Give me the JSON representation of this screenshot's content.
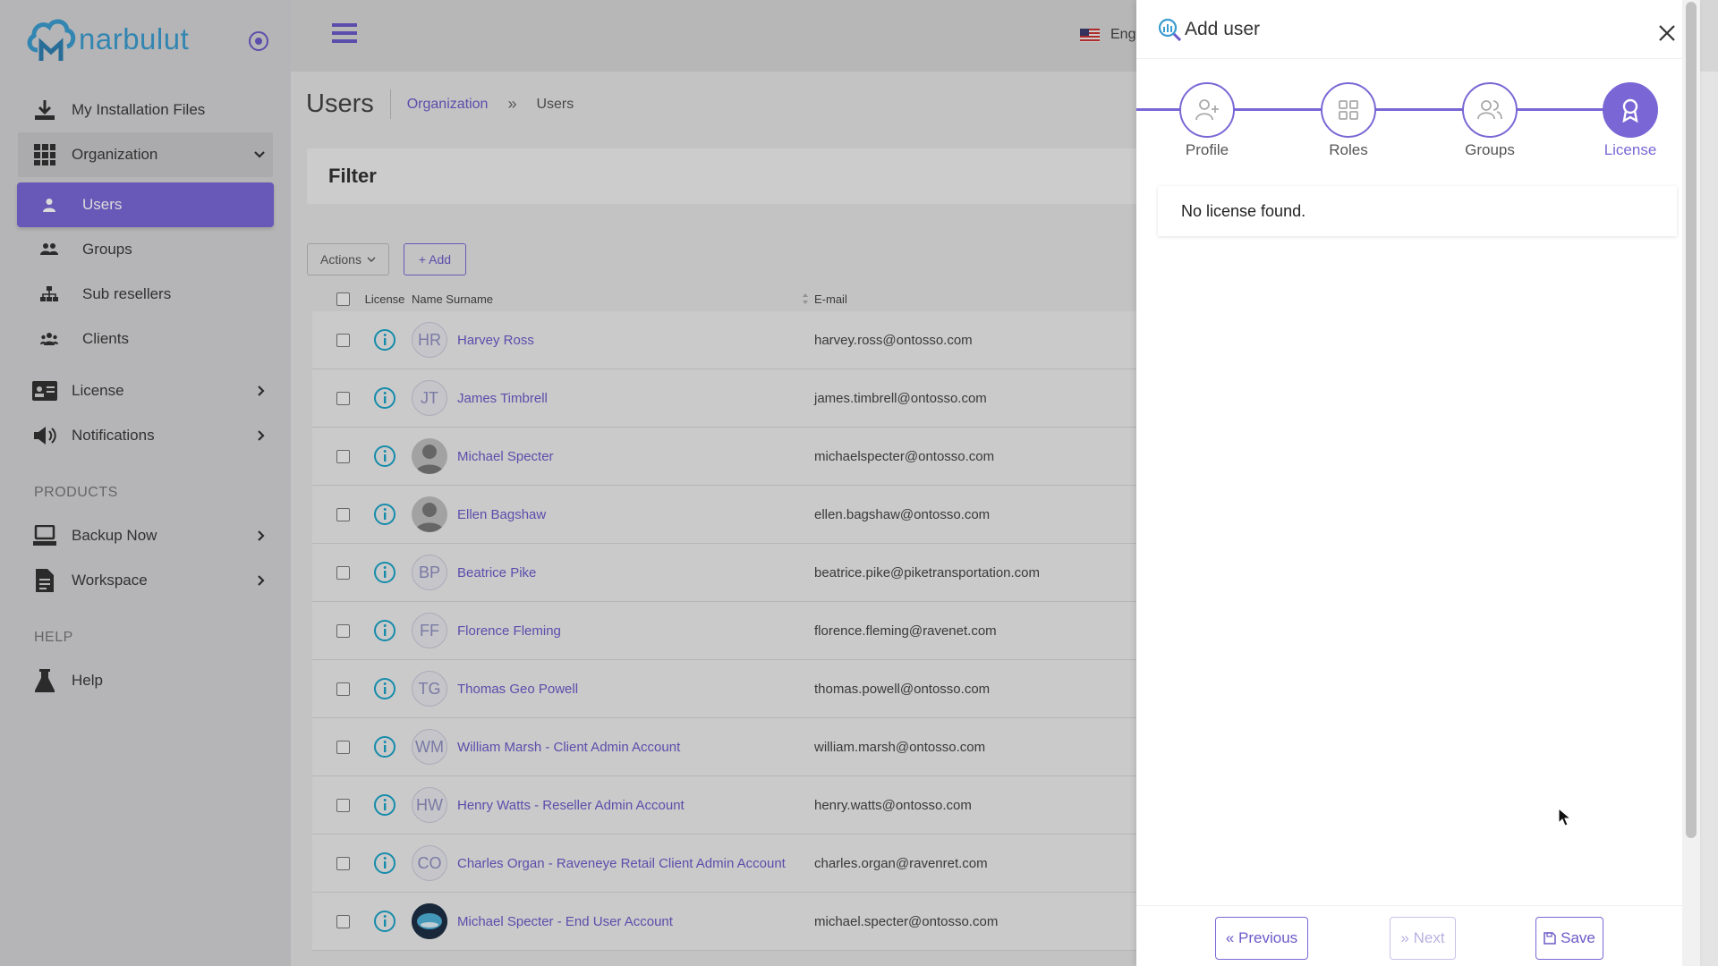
{
  "app": {
    "brand": "narbulut"
  },
  "sidebar": {
    "items": [
      {
        "label": "My Installation Files",
        "icon": "download-icon"
      },
      {
        "label": "Organization",
        "icon": "grid-icon"
      },
      {
        "label": "Users",
        "icon": "user-icon"
      },
      {
        "label": "Groups",
        "icon": "users-icon"
      },
      {
        "label": "Sub resellers",
        "icon": "sitemap-icon"
      },
      {
        "label": "Clients",
        "icon": "clients-icon"
      },
      {
        "label": "License",
        "icon": "id-card-icon"
      },
      {
        "label": "Notifications",
        "icon": "megaphone-icon"
      }
    ],
    "products_label": "PRODUCTS",
    "products": [
      {
        "label": "Backup Now",
        "icon": "server-icon"
      },
      {
        "label": "Workspace",
        "icon": "document-icon"
      }
    ],
    "help_label": "HELP",
    "help": {
      "label": "Help",
      "icon": "flask-icon"
    }
  },
  "header": {
    "language": "Eng"
  },
  "page": {
    "title": "Users",
    "breadcrumb": {
      "parent": "Organization",
      "sep": "»",
      "current": "Users"
    },
    "filter_title": "Filter",
    "actions_label": "Actions",
    "add_label": "+ Add"
  },
  "table": {
    "headers": {
      "license": "License",
      "name": "Name Surname",
      "email": "E-mail"
    },
    "rows": [
      {
        "initials": "HR",
        "name": "Harvey Ross",
        "email": "harvey.ross@ontosso.com",
        "avatar": "initials"
      },
      {
        "initials": "JT",
        "name": "James Timbrell",
        "email": "james.timbrell@ontosso.com",
        "avatar": "initials"
      },
      {
        "initials": "",
        "name": "Michael Specter",
        "email": "michaelspecter@ontosso.com",
        "avatar": "photo"
      },
      {
        "initials": "",
        "name": "Ellen Bagshaw",
        "email": "ellen.bagshaw@ontosso.com",
        "avatar": "photo"
      },
      {
        "initials": "BP",
        "name": "Beatrice Pike",
        "email": "beatrice.pike@piketransportation.com",
        "avatar": "initials"
      },
      {
        "initials": "FF",
        "name": "Florence Fleming",
        "email": "florence.fleming@ravenet.com",
        "avatar": "initials"
      },
      {
        "initials": "TG",
        "name": "Thomas Geo Powell",
        "email": "thomas.powell@ontosso.com",
        "avatar": "initials"
      },
      {
        "initials": "WM",
        "name": "William Marsh - Client Admin Account",
        "email": "william.marsh@ontosso.com",
        "avatar": "initials"
      },
      {
        "initials": "HW",
        "name": "Henry Watts - Reseller Admin Account",
        "email": "henry.watts@ontosso.com",
        "avatar": "initials"
      },
      {
        "initials": "CO",
        "name": "Charles Organ - Raveneye Retail Client Admin Account",
        "email": "charles.organ@ravenret.com",
        "avatar": "initials"
      },
      {
        "initials": "",
        "name": "Michael Specter - End User Account",
        "email": "michael.specter@ontosso.com",
        "avatar": "globe"
      }
    ]
  },
  "drawer": {
    "title": "Add user",
    "steps": [
      {
        "label": "Profile",
        "icon": "user-plus-icon"
      },
      {
        "label": "Roles",
        "icon": "grid-icon"
      },
      {
        "label": "Groups",
        "icon": "users-icon"
      },
      {
        "label": "License",
        "icon": "award-icon"
      }
    ],
    "active_step": "License",
    "message": "No license found.",
    "buttons": {
      "previous": "« Previous",
      "next": "» Next",
      "save": "Save"
    }
  },
  "colors": {
    "accent": "#7a67d5",
    "link": "#6a5ac8",
    "brand": "#3b9ccf",
    "info": "#1aa3c7"
  }
}
